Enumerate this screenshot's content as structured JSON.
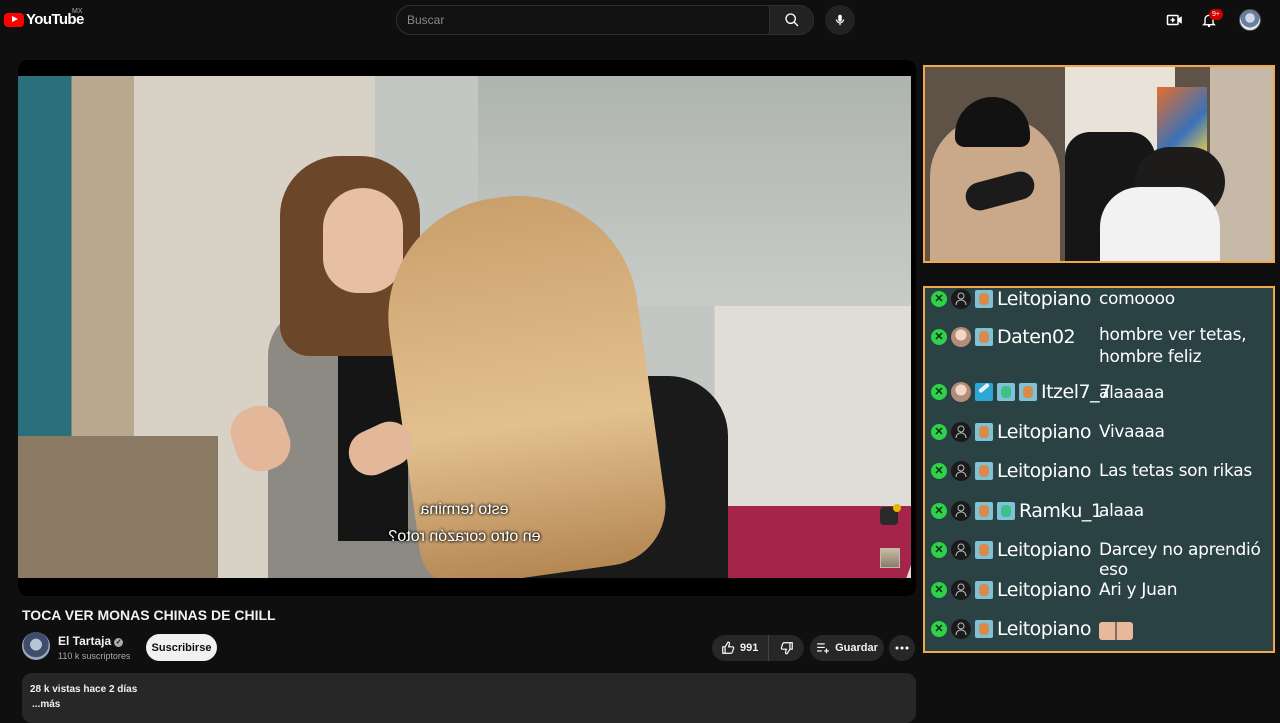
{
  "header": {
    "logo_text": "YouTube",
    "country_code": "MX",
    "search_placeholder": "Buscar",
    "notifications_badge": "9+",
    "icons": [
      "youtube-logo-icon",
      "search-icon",
      "mic-icon",
      "create-video-icon",
      "bell-icon",
      "account-avatar"
    ]
  },
  "video": {
    "subtitle_line1": "esto termina",
    "subtitle_line2": "en otro corazón roto?",
    "title": "TOCA VER MONAS CHINAS DE CHILL"
  },
  "channel": {
    "name": "El Tartaja",
    "verified_glyph": "✓",
    "subscribers": "110 k suscriptores",
    "subscribe_label": "Suscribirse"
  },
  "actions": {
    "likes": "991",
    "save_label": "Guardar"
  },
  "description": {
    "meta": "28 k vistas  hace 2 días",
    "more_label": "...más"
  },
  "chat": {
    "mod_glyph": "✕",
    "messages": [
      {
        "user": "Leitopiano",
        "text": "comoooo"
      },
      {
        "user": "Daten02",
        "text_line1": "hombre ver tetas,",
        "text_line2": "hombre feliz"
      },
      {
        "user": "Itzel7_7",
        "text": "alaaaaa"
      },
      {
        "user": "Leitopiano",
        "text": "Vivaaaa"
      },
      {
        "user": "Leitopiano",
        "text": "Las tetas son rikas"
      },
      {
        "user": "Ramku_1",
        "text": "alaaa"
      },
      {
        "user": "Leitopiano",
        "text": "Darcey no aprendió eso"
      },
      {
        "user": "Leitopiano",
        "text": "Ari y Juan"
      },
      {
        "user": "Leitopiano",
        "text": ""
      }
    ]
  },
  "colors": {
    "page_bg": "#0f0f0f",
    "overlay_border": "#f0a84a",
    "chat_bg": "#2d4648",
    "mod_badge": "#2fd04a",
    "brand_red": "#ff0000"
  }
}
